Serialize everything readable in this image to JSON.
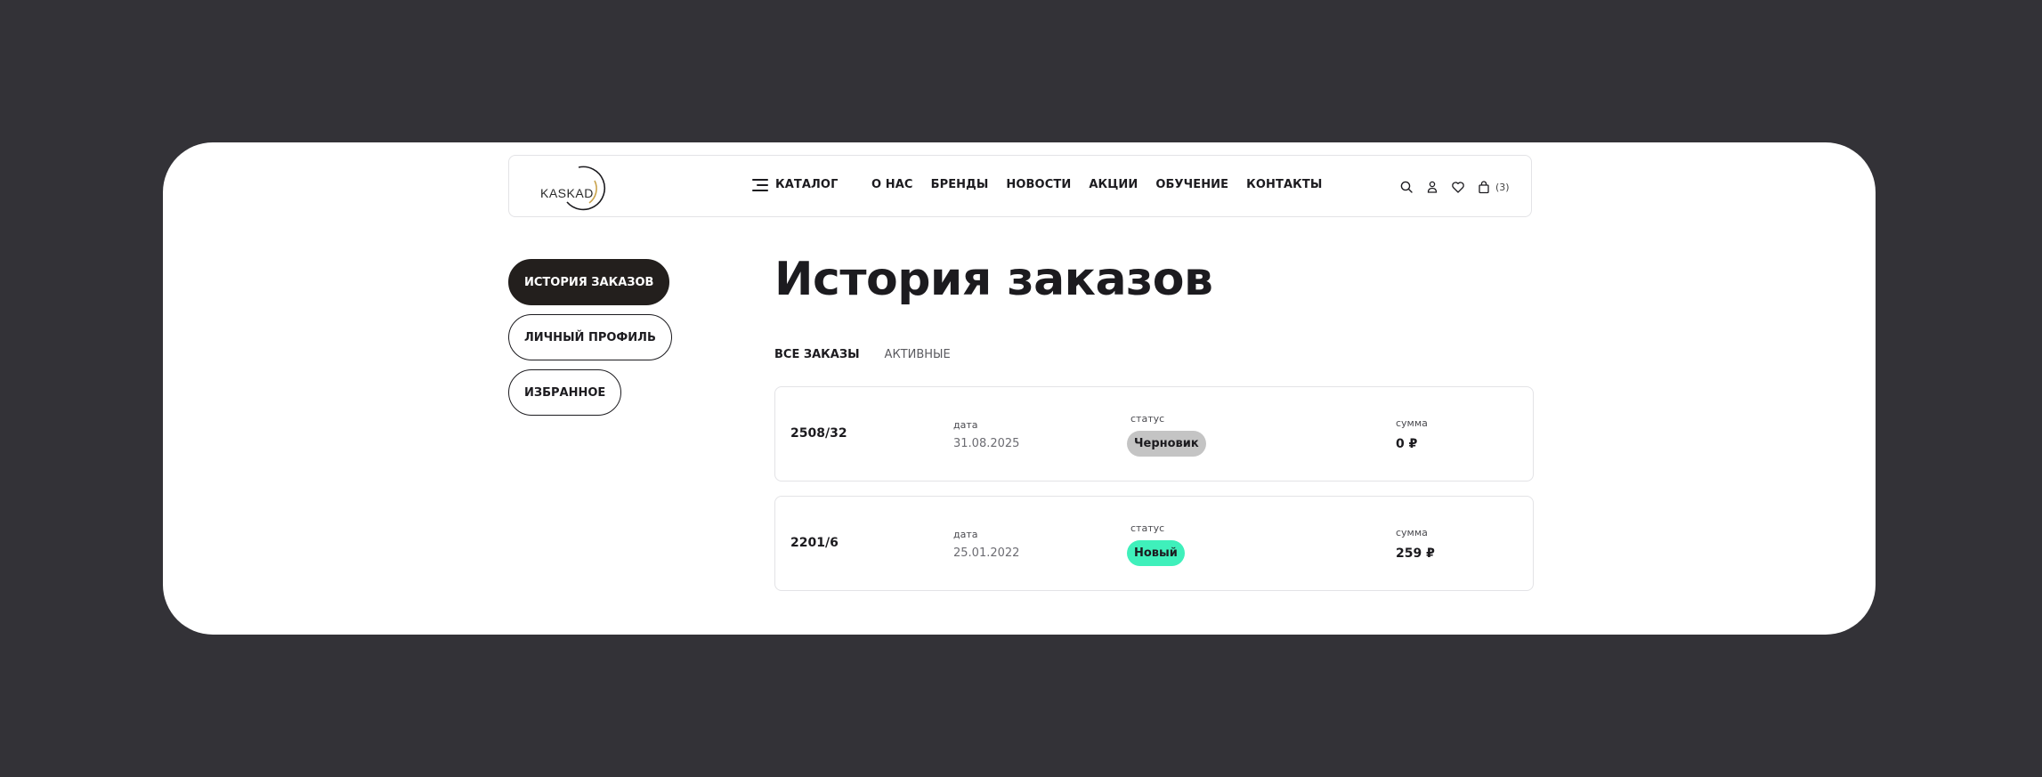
{
  "header": {
    "logo_text": "KASKAD",
    "catalog_label": "КАТАЛОГ",
    "nav": [
      "О НАС",
      "БРЕНДЫ",
      "НОВОСТИ",
      "АКЦИИ",
      "ОБУЧЕНИЕ",
      "КОНТАКТЫ"
    ],
    "icons": [
      "search-icon",
      "user-icon",
      "heart-icon",
      "bag-icon"
    ],
    "cart_count": "(3)"
  },
  "sidebar": {
    "items": [
      {
        "label": "ИСТОРИЯ ЗАКАЗОВ",
        "active": true
      },
      {
        "label": "ЛИЧНЫЙ ПРОФИЛЬ",
        "active": false
      },
      {
        "label": "ИЗБРАННОЕ",
        "active": false
      }
    ]
  },
  "main": {
    "title": "История заказов",
    "tabs": [
      {
        "label": "ВСЕ ЗАКАЗЫ",
        "active": true
      },
      {
        "label": "АКТИВНЫЕ",
        "active": false
      }
    ],
    "columns": {
      "date": "дата",
      "status": "статус",
      "sum": "сумма"
    },
    "orders": [
      {
        "number": "2508/32",
        "date": "31.08.2025",
        "status": "Черновик",
        "status_color": "#c4c4c4",
        "sum": "0 ₽"
      },
      {
        "number": "2201/6",
        "date": "25.01.2022",
        "status": "Новый",
        "status_color": "#3ff0bb",
        "sum": "259 ₽"
      }
    ]
  },
  "colors": {
    "background": "#333237",
    "panel": "#ffffff",
    "active_button": "#231f1d",
    "logo_accent": "#c9a24a"
  }
}
